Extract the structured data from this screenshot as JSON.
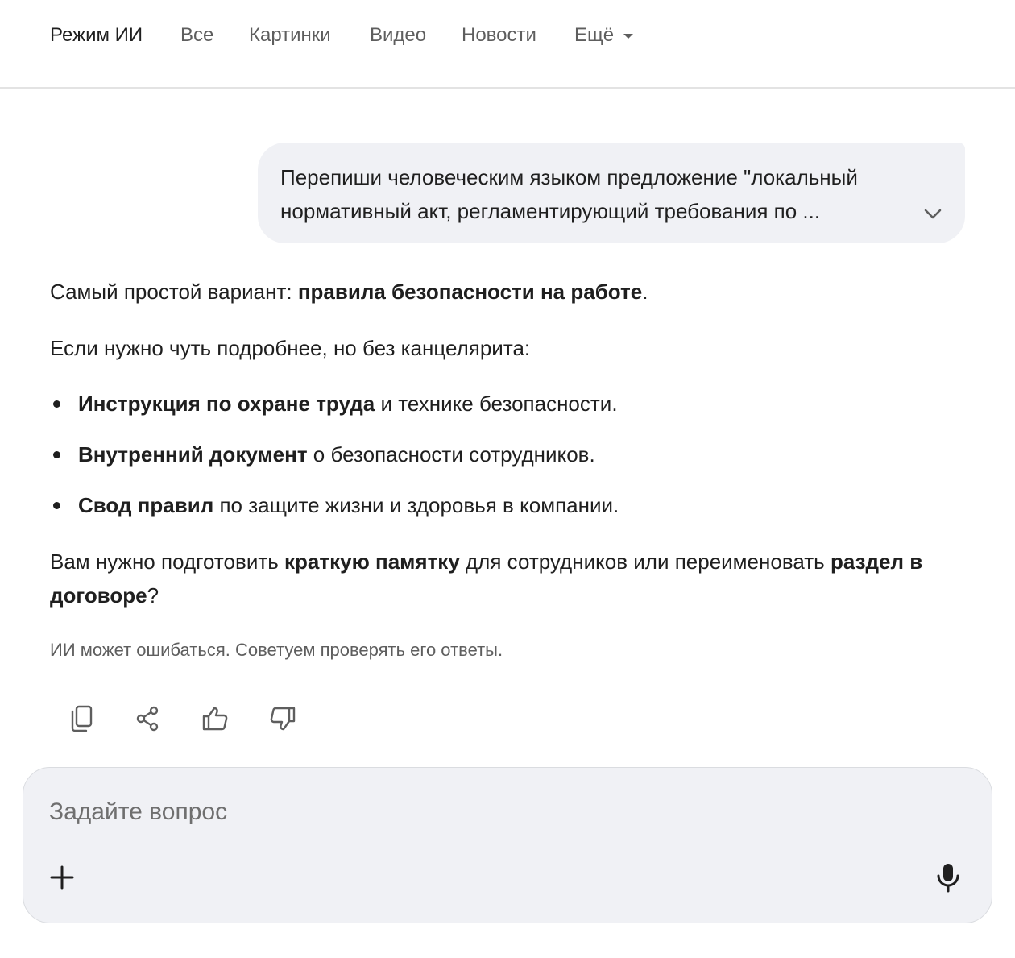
{
  "nav": {
    "tabs": [
      {
        "label": "Режим ИИ"
      },
      {
        "label": "Все"
      },
      {
        "label": "Картинки"
      },
      {
        "label": "Видео"
      },
      {
        "label": "Новости"
      },
      {
        "label": "Ещё"
      }
    ]
  },
  "user_message": {
    "text": "Перепиши человеческим языком предложение \"локальный нормативный акт, регламентирующий требования по ...",
    "expand_icon": "chevron-down-icon"
  },
  "answer": {
    "p1": {
      "pre": "Самый простой вариант: ",
      "bold": "правила безопасности на работе",
      "post": "."
    },
    "p2": "Если нужно чуть подробнее, но без канцелярита:",
    "bullets": [
      {
        "bold": "Инструкция по охране труда",
        "rest": " и технике безопасности."
      },
      {
        "bold": "Внутренний документ",
        "rest": " о безопасности сотрудников."
      },
      {
        "bold": "Свод правил",
        "rest": " по защите жизни и здоровья в компании."
      }
    ],
    "p3": {
      "a": "Вам нужно подготовить ",
      "b1": "краткую памятку",
      "c": " для сотрудников или переименовать ",
      "b2": "раздел в договоре",
      "d": "?"
    }
  },
  "disclaimer": "ИИ может ошибаться. Советуем проверять его ответы.",
  "actions": [
    "copy-icon",
    "share-icon",
    "thumbs-up-icon",
    "thumbs-down-icon"
  ],
  "composer": {
    "placeholder": "Задайте вопрос",
    "value": "",
    "plus_icon": "plus-icon",
    "mic_icon": "microphone-icon"
  },
  "colors": {
    "text": "#1f1f1f",
    "muted": "#5e5e5e",
    "bubble_bg": "#f0f1f5",
    "divider": "#e3e3e3"
  }
}
